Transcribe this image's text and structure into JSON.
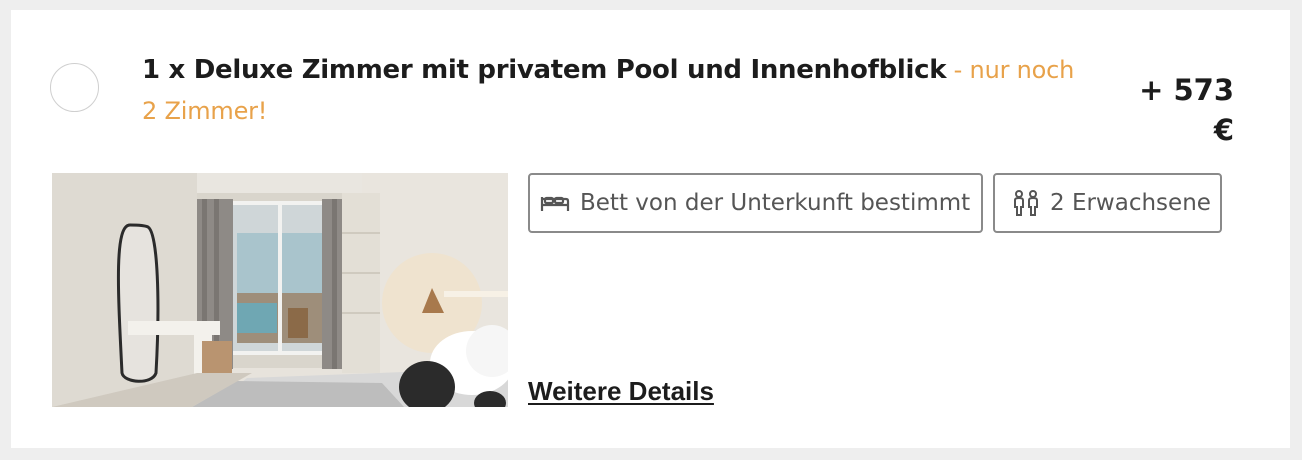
{
  "room": {
    "title": "1 x Deluxe Zimmer mit privatem Pool und Innenhofblick",
    "availability": " - nur noch 2 Zimmer!",
    "price": "+ 573 €"
  },
  "chips": {
    "bed": {
      "icon": "bed-icon",
      "label": "Bett von der Unterkunft bestimmt"
    },
    "guests": {
      "icon": "two-persons-icon",
      "label": "2 Erwachsene"
    }
  },
  "links": {
    "details": "Weitere Details"
  },
  "colors": {
    "availability": "#e8a24a",
    "chip_border": "#8a8a8a",
    "text": "#1c1c1c",
    "page_background": "#eeeeee"
  }
}
